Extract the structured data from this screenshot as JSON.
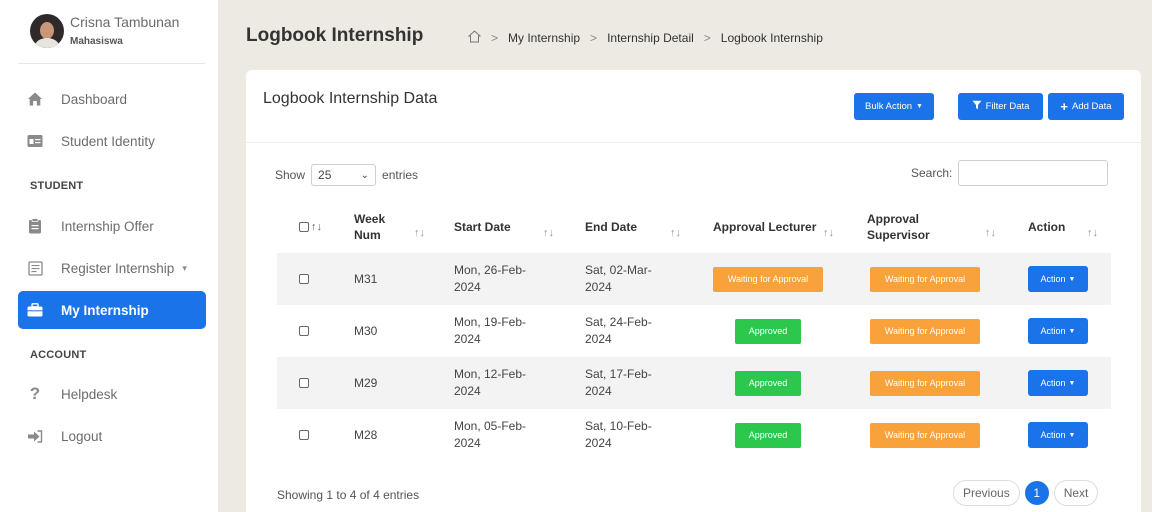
{
  "user": {
    "name": "Crisna Tambunan",
    "role": "Mahasiswa"
  },
  "sidebar": {
    "items": [
      {
        "label": "Dashboard",
        "icon": "home-icon"
      },
      {
        "label": "Student Identity",
        "icon": "id-card-icon"
      },
      {
        "label": "Internship Offer",
        "icon": "clipboard-icon"
      },
      {
        "label": "Register Internship",
        "icon": "form-icon",
        "caret": "▾"
      },
      {
        "label": "My Internship",
        "icon": "briefcase-icon",
        "active": true
      },
      {
        "label": "Helpdesk",
        "icon": "question-icon"
      },
      {
        "label": "Logout",
        "icon": "logout-icon"
      }
    ],
    "sections": {
      "student": "STUDENT",
      "account": "ACCOUNT"
    }
  },
  "header": {
    "title": "Logbook Internship",
    "breadcrumb": [
      "My Internship",
      "Internship Detail",
      "Logbook Internship"
    ]
  },
  "card": {
    "title": "Logbook Internship Data",
    "buttons": {
      "bulk": "Bulk Action",
      "filter": "Filter Data",
      "add": "Add Data"
    }
  },
  "controls": {
    "show": "Show",
    "entries_value": "25",
    "entries": "entries",
    "search": "Search:"
  },
  "table": {
    "headers": {
      "week1": "Week",
      "week2": "Num",
      "start": "Start Date",
      "end": "End Date",
      "lecturer": "Approval Lecturer",
      "supervisor1": "Approval",
      "supervisor2": "Supervisor",
      "action": "Action"
    },
    "rows": [
      {
        "week": "M31",
        "start1": "Mon, 26-Feb-",
        "start2": "2024",
        "end1": "Sat, 02-Mar-",
        "end2": "2024",
        "lecturer": "Waiting for Approval",
        "supervisor": "Waiting for Approval",
        "action": "Action"
      },
      {
        "week": "M30",
        "start1": "Mon, 19-Feb-",
        "start2": "2024",
        "end1": "Sat, 24-Feb-",
        "end2": "2024",
        "lecturer": "Approved",
        "supervisor": "Waiting for Approval",
        "action": "Action"
      },
      {
        "week": "M29",
        "start1": "Mon, 12-Feb-",
        "start2": "2024",
        "end1": "Sat, 17-Feb-",
        "end2": "2024",
        "lecturer": "Approved",
        "supervisor": "Waiting for Approval",
        "action": "Action"
      },
      {
        "week": "M28",
        "start1": "Mon, 05-Feb-",
        "start2": "2024",
        "end1": "Sat, 10-Feb-",
        "end2": "2024",
        "lecturer": "Approved",
        "supervisor": "Waiting for Approval",
        "action": "Action"
      }
    ]
  },
  "footer": {
    "info": "Showing 1 to 4 of 4 entries",
    "previous": "Previous",
    "page": "1",
    "next": "Next"
  },
  "colors": {
    "primary": "#1a73e8",
    "waiting": "#f9a23b",
    "approved": "#2cc84d"
  }
}
